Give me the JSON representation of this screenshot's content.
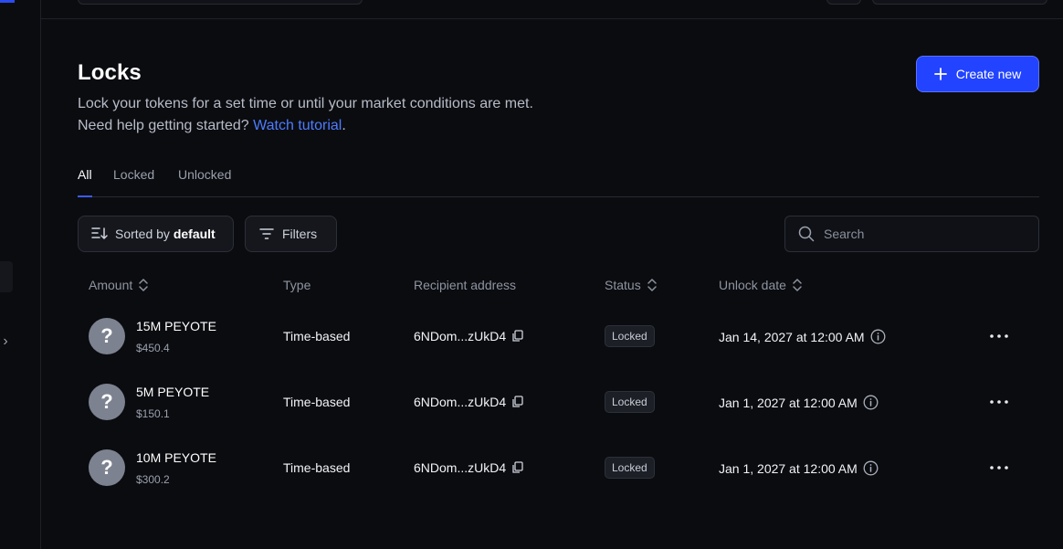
{
  "header": {
    "title": "Locks",
    "subtitle": "Lock your tokens for a set time or until your market conditions are met. Need help getting started?",
    "subtitle_link": "Watch tutorial",
    "subtitle_end": ".",
    "create_label": "Create new"
  },
  "tabs": [
    {
      "label": "All",
      "active": true
    },
    {
      "label": "Locked",
      "active": false
    },
    {
      "label": "Unlocked",
      "active": false
    }
  ],
  "toolbar": {
    "sort_prefix": "Sorted by",
    "sort_value": "default",
    "filters_label": "Filters",
    "search_placeholder": "Search"
  },
  "table": {
    "columns": [
      "Amount",
      "Type",
      "Recipient address",
      "Status",
      "Unlock date"
    ],
    "rows": [
      {
        "token": "15M PEYOTE",
        "usd": "$450.4",
        "type": "Time-based",
        "recipient": "6NDom...zUkD4",
        "status": "Locked",
        "unlock": "Jan 14, 2027 at 12:00 AM"
      },
      {
        "token": "5M PEYOTE",
        "usd": "$150.1",
        "type": "Time-based",
        "recipient": "6NDom...zUkD4",
        "status": "Locked",
        "unlock": "Jan 1, 2027 at 12:00 AM"
      },
      {
        "token": "10M PEYOTE",
        "usd": "$300.2",
        "type": "Time-based",
        "recipient": "6NDom...zUkD4",
        "status": "Locked",
        "unlock": "Jan 1, 2027 at 12:00 AM"
      }
    ]
  },
  "icons": {
    "token_placeholder": "?",
    "sidebar_expand": "›"
  },
  "colors": {
    "accent": "#2243ff",
    "link": "#4d7cff",
    "background": "#0b0c10"
  }
}
